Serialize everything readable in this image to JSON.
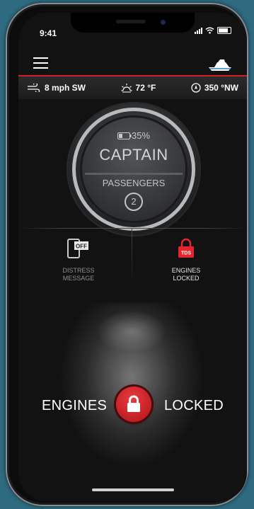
{
  "status_bar": {
    "time": "9:41"
  },
  "weather": {
    "wind": "8 mph SW",
    "temperature": "72 °F",
    "heading": "350 °NW"
  },
  "gauge": {
    "battery_percent": "35%",
    "role": "CAPTAIN",
    "passengers_label": "PASSENGERS",
    "passenger_count": "2"
  },
  "actions": {
    "distress": {
      "badge": "OFF",
      "label_line1": "DISTRESS",
      "label_line2": "MESSAGE"
    },
    "engines": {
      "badge": "TDS",
      "label_line1": "ENGINES",
      "label_line2": "LOCKED"
    }
  },
  "engine_status": {
    "left_label": "ENGINES",
    "right_label": "LOCKED"
  },
  "colors": {
    "accent_red": "#d21f26",
    "background": "#121213",
    "outer": "#2e6b80"
  }
}
